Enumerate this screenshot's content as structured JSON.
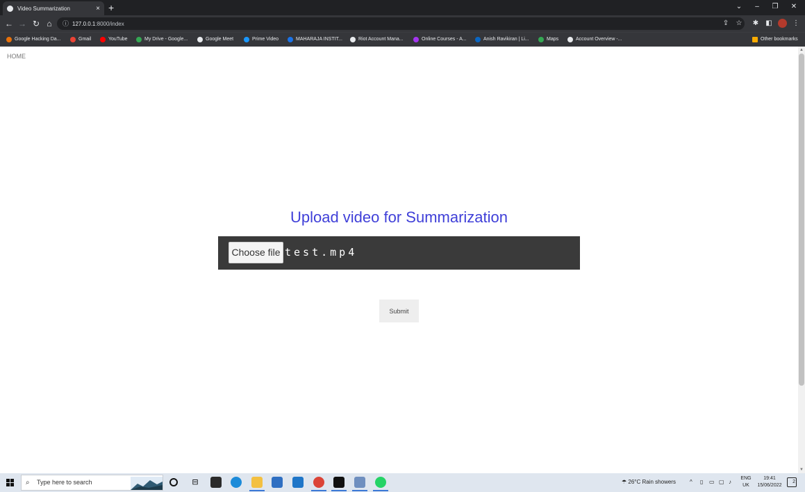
{
  "browser": {
    "tab_title": "Video Summarization",
    "tab_close": "×",
    "new_tab": "+",
    "url_host": "127.0.0.1",
    "url_path": ":8000/index",
    "bookmarks": [
      {
        "label": "Google Hacking Da...",
        "color": "#e8710a"
      },
      {
        "label": "Gmail",
        "color": "#ea4335"
      },
      {
        "label": "YouTube",
        "color": "#ff0000"
      },
      {
        "label": "My Drive - Google...",
        "color": "#34a853"
      },
      {
        "label": "Google Meet",
        "color": "#e8eaed"
      },
      {
        "label": "Prime Video",
        "color": "#1a98ff"
      },
      {
        "label": "MAHARAJA INSTIT...",
        "color": "#1a73e8"
      },
      {
        "label": "Riot Account Mana...",
        "color": "#e8eaed"
      },
      {
        "label": "Online Courses - A...",
        "color": "#a435f0"
      },
      {
        "label": "Anish Ravikiran | Li...",
        "color": "#0a66c2"
      },
      {
        "label": "Maps",
        "color": "#34a853"
      },
      {
        "label": "Account Overview -...",
        "color": "#e8eaed"
      }
    ],
    "other_bookmarks": "Other bookmarks"
  },
  "page": {
    "home_link": "HOME",
    "heading": "Upload video for Summarization",
    "choose_file_label": "Choose file",
    "file_name": "test.mp4",
    "submit_label": "Submit"
  },
  "taskbar": {
    "search_placeholder": "Type here to search",
    "weather": "26°C  Rain showers",
    "lang_top": "ENG",
    "lang_bottom": "UK",
    "time": "19:41",
    "date": "15/06/2022",
    "notifications": "2"
  },
  "colors": {
    "accent": "#3f3fd8",
    "file_box": "#3a3a3a"
  }
}
